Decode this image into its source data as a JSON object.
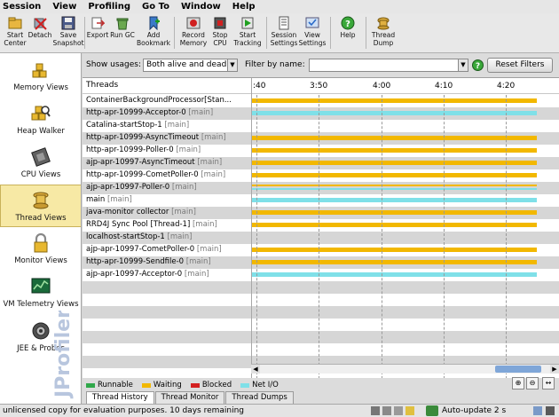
{
  "menu": [
    "Session",
    "View",
    "Profiling",
    "Go To",
    "Window",
    "Help"
  ],
  "toolbar": [
    {
      "label": "Start\nCenter",
      "icon": "start-center-icon"
    },
    {
      "label": "Detach",
      "icon": "detach-icon"
    },
    {
      "label": "Save\nSnapshot",
      "icon": "save-snapshot-icon"
    },
    {
      "label": "Export",
      "icon": "export-icon"
    },
    {
      "label": "Run GC",
      "icon": "run-gc-icon"
    },
    {
      "label": "Add\nBookmark",
      "icon": "add-bookmark-icon"
    },
    {
      "label": "Record\nMemory",
      "icon": "record-memory-icon"
    },
    {
      "label": "Stop\nCPU",
      "icon": "stop-cpu-icon"
    },
    {
      "label": "Start\nTracking",
      "icon": "start-tracking-icon"
    },
    {
      "label": "Session\nSettings",
      "icon": "session-settings-icon"
    },
    {
      "label": "View\nSettings",
      "icon": "view-settings-icon"
    },
    {
      "label": "Help",
      "icon": "help-icon"
    },
    {
      "label": "Thread\nDump",
      "icon": "thread-dump-icon"
    }
  ],
  "nav": [
    {
      "label": "Memory Views",
      "icon": "memory-views-icon",
      "active": false
    },
    {
      "label": "Heap Walker",
      "icon": "heap-walker-icon",
      "active": false
    },
    {
      "label": "CPU Views",
      "icon": "cpu-views-icon",
      "active": false
    },
    {
      "label": "Thread Views",
      "icon": "thread-views-icon",
      "active": true
    },
    {
      "label": "Monitor Views",
      "icon": "monitor-views-icon",
      "active": false
    },
    {
      "label": "VM Telemetry Views",
      "icon": "vm-telemetry-icon",
      "active": false
    },
    {
      "label": "JEE & Probes",
      "icon": "jee-probes-icon",
      "active": false
    }
  ],
  "brand": "JProfiler",
  "filter": {
    "show_usages_label": "Show usages:",
    "show_usages_value": "Both alive and dead",
    "filter_name_label": "Filter by name:",
    "filter_name_value": "",
    "reset_label": "Reset Filters"
  },
  "table": {
    "column": "Threads",
    "ticks": [
      ":40",
      "3:50",
      "4:00",
      "4:10",
      "4:20"
    ],
    "rows": [
      {
        "name": "ContainerBackgroundProcessor[Stan...",
        "group": "",
        "state": "Waiting"
      },
      {
        "name": "http-apr-10999-Acceptor-0",
        "group": "[main]",
        "state": "Net I/O"
      },
      {
        "name": "Catalina-startStop-1",
        "group": "[main]",
        "state": ""
      },
      {
        "name": "http-apr-10999-AsyncTimeout",
        "group": "[main]",
        "state": "Waiting"
      },
      {
        "name": "http-apr-10999-Poller-0",
        "group": "[main]",
        "state": "Waiting"
      },
      {
        "name": "ajp-apr-10997-AsyncTimeout",
        "group": "[main]",
        "state": "Waiting"
      },
      {
        "name": "http-apr-10999-CometPoller-0",
        "group": "[main]",
        "state": "Waiting"
      },
      {
        "name": "ajp-apr-10997-Poller-0",
        "group": "[main]",
        "state": "Waiting+Net I/O"
      },
      {
        "name": "main",
        "group": "[main]",
        "state": "Net I/O"
      },
      {
        "name": "java-monitor collector",
        "group": "[main]",
        "state": "Waiting"
      },
      {
        "name": "RRD4J Sync Pool [Thread-1]",
        "group": "[main]",
        "state": "Waiting"
      },
      {
        "name": "localhost-startStop-1",
        "group": "[main]",
        "state": ""
      },
      {
        "name": "ajp-apr-10997-CometPoller-0",
        "group": "[main]",
        "state": "Waiting"
      },
      {
        "name": "http-apr-10999-Sendfile-0",
        "group": "[main]",
        "state": "Waiting"
      },
      {
        "name": "ajp-apr-10997-Acceptor-0",
        "group": "[main]",
        "state": "Net I/O"
      }
    ]
  },
  "legend": [
    {
      "label": "Runnable",
      "color": "#2fa84a"
    },
    {
      "label": "Waiting",
      "color": "#f2b800"
    },
    {
      "label": "Blocked",
      "color": "#d31f1f"
    },
    {
      "label": "Net I/O",
      "color": "#7fe0e8"
    }
  ],
  "tabs": [
    {
      "label": "Thread History",
      "active": true
    },
    {
      "label": "Thread Monitor",
      "active": false
    },
    {
      "label": "Thread Dumps",
      "active": false
    }
  ],
  "status": {
    "message": "unlicensed copy for evaluation purposes. 10 days remaining",
    "auto_update": "Auto-update 2 s"
  }
}
